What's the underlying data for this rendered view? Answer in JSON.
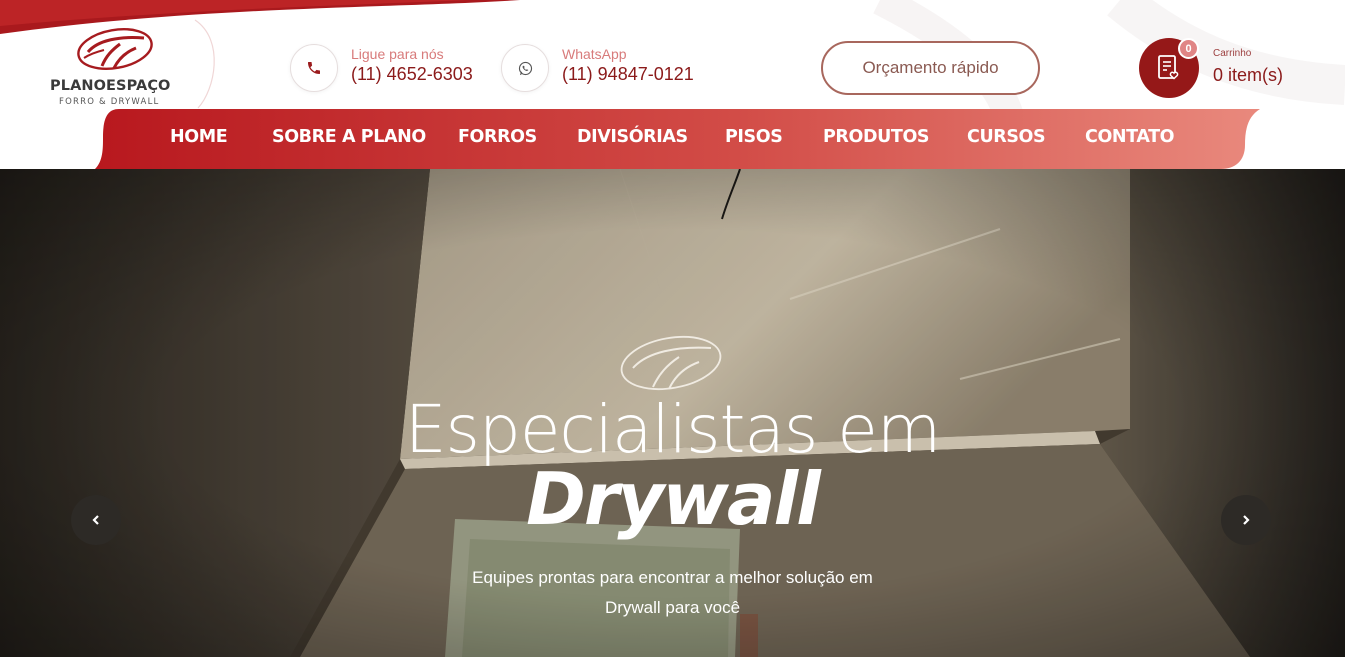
{
  "brand": {
    "name": "PLANOESPAÇO",
    "tagline": "FORRO & DRYWALL"
  },
  "contacts": {
    "phone": {
      "label": "Ligue para nós",
      "value": "(11) 4652-6303",
      "icon": "phone-icon"
    },
    "whatsapp": {
      "label": "WhatsApp",
      "value": "(11) 94847-0121",
      "icon": "whatsapp-icon"
    }
  },
  "quote_button": {
    "label": "Orçamento rápido"
  },
  "cart": {
    "badge": "0",
    "label": "Carrinho",
    "count": "0 item(s)",
    "icon": "cart-list-icon"
  },
  "nav": {
    "items": [
      {
        "label": "HOME"
      },
      {
        "label": "SOBRE A PLANO"
      },
      {
        "label": "FORROS"
      },
      {
        "label": "DIVISÓRIAS"
      },
      {
        "label": "PISOS"
      },
      {
        "label": "PRODUTOS"
      },
      {
        "label": "CURSOS"
      },
      {
        "label": "CONTATO"
      }
    ]
  },
  "hero": {
    "title": "Especialistas em",
    "title_emphasis": "Drywall",
    "subtitle": "Equipes prontas para encontrar a melhor solução em Drywall para você",
    "prev_icon": "chevron-left-icon",
    "next_icon": "chevron-right-icon"
  },
  "colors": {
    "brand_dark": "#8b1a1a",
    "brand_red": "#b61f24",
    "nav_gradient_end": "#e8857a",
    "muted_label": "#d87b7b"
  }
}
